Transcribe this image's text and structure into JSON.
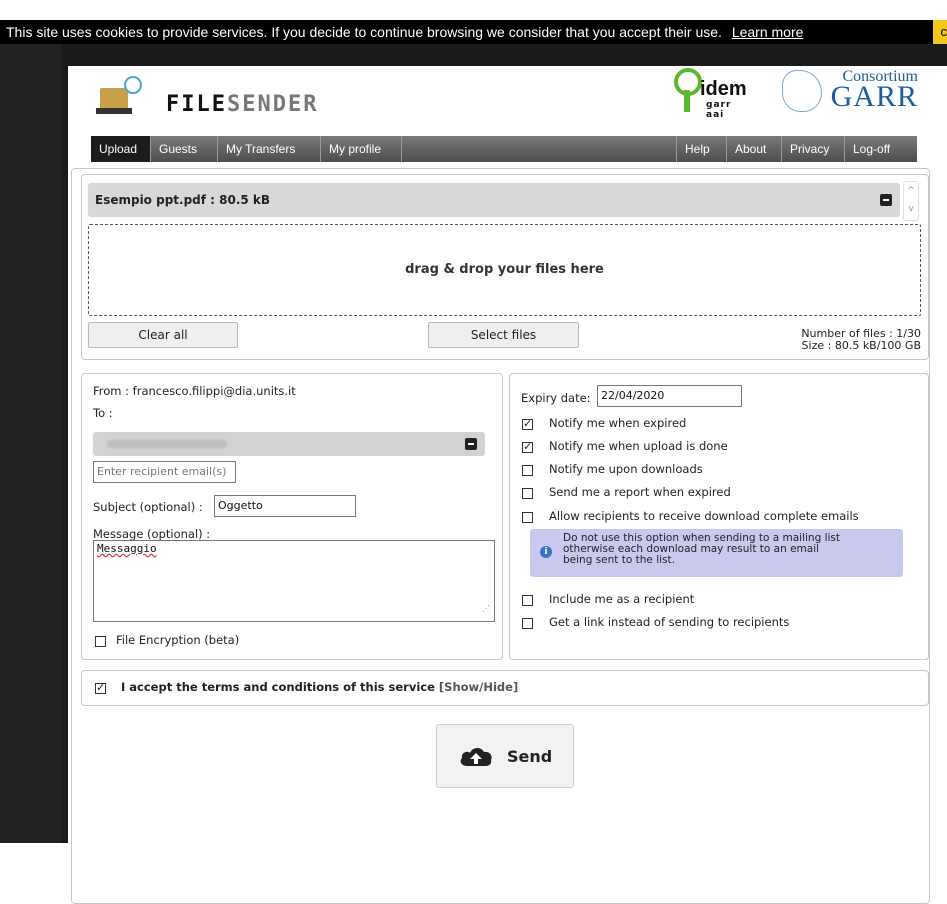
{
  "cookie": {
    "message": "This site uses cookies to provide services. If you decide to continue browsing we consider that you accept their use.",
    "learn_more": "Learn more",
    "ok_partial": "c"
  },
  "brand": {
    "name_bold": "FILE",
    "name_light": "SENDER"
  },
  "partner_logos": {
    "idem": "idem",
    "idem_sub": "garr aai",
    "consortium": "Consortium",
    "garr": "GARR"
  },
  "nav": {
    "left": [
      "Upload",
      "Guests",
      "My Transfers",
      "My profile"
    ],
    "right": [
      "Help",
      "About",
      "Privacy",
      "Log-off"
    ],
    "active": "Upload"
  },
  "upload": {
    "file_entry": "Esempio ppt.pdf : 80.5 kB",
    "dropzone_text": "drag & drop your files here",
    "clear_all": "Clear all",
    "select_files": "Select files",
    "number_of_files": "Number of files : 1/30",
    "size": "Size : 80.5 kB/100 GB"
  },
  "form": {
    "from": "From : francesco.filippi@dia.units.it",
    "to_label": "To :",
    "recipient_placeholder": "Enter recipient email(s)",
    "subject_label": "Subject (optional) :",
    "subject_value": "Oggetto",
    "message_label": "Message (optional) :",
    "message_value": "Messaggio",
    "file_encryption": "File Encryption (beta)"
  },
  "options": {
    "expiry_label": "Expiry date:",
    "expiry_value": "22/04/2020",
    "notify_expired": "Notify me when expired",
    "notify_upload_done": "Notify me when upload is done",
    "notify_downloads": "Notify me upon downloads",
    "report_expired": "Send me a report when expired",
    "allow_download_emails": "Allow recipients to receive download complete emails",
    "info_line1": "Do not use this option when sending to a mailing list",
    "info_line2": "otherwise each download may result to an email",
    "info_line3": "being sent to the list.",
    "include_me": "Include me as a recipient",
    "get_link": "Get a link instead of sending to recipients",
    "checked": {
      "notify_expired": true,
      "notify_upload_done": true,
      "notify_downloads": false,
      "report_expired": false,
      "allow_download_emails": false,
      "include_me": false,
      "get_link": false,
      "file_encryption": false,
      "terms": true
    }
  },
  "terms": {
    "text": "I accept the terms and conditions of this service",
    "toggle": "[Show/Hide]"
  },
  "send": {
    "label": "Send"
  }
}
